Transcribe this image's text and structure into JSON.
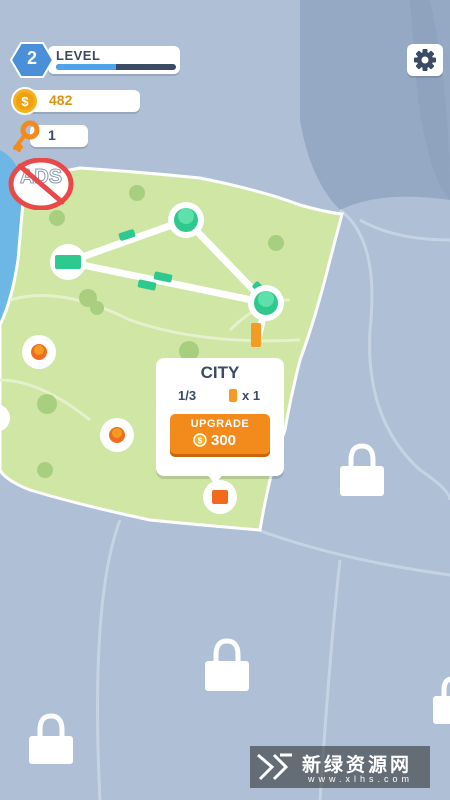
{
  "hud": {
    "level": {
      "number": "2",
      "label": "LEVEL",
      "progress": 0.5
    },
    "coins": "482",
    "keys": "1",
    "ads_label": "ADS",
    "settings_icon": "gear-icon",
    "no_ads_icon": "no-ads-icon"
  },
  "map": {
    "city_nodes": 3,
    "locked_regions": 4,
    "unbuilt_nodes": 3
  },
  "popup": {
    "title": "CITY",
    "progress": "1/3",
    "battery_count": "x 1",
    "upgrade_label": "UPGRADE",
    "upgrade_cost": "300"
  },
  "watermark": {
    "name": "新绿资源网",
    "url": "www.xlhs.com"
  },
  "colors": {
    "land": "#cfe6a4",
    "sea": "#aebfd6",
    "node": "#2ec98f",
    "accent": "#f28b1c",
    "text": "#3b4b63"
  }
}
